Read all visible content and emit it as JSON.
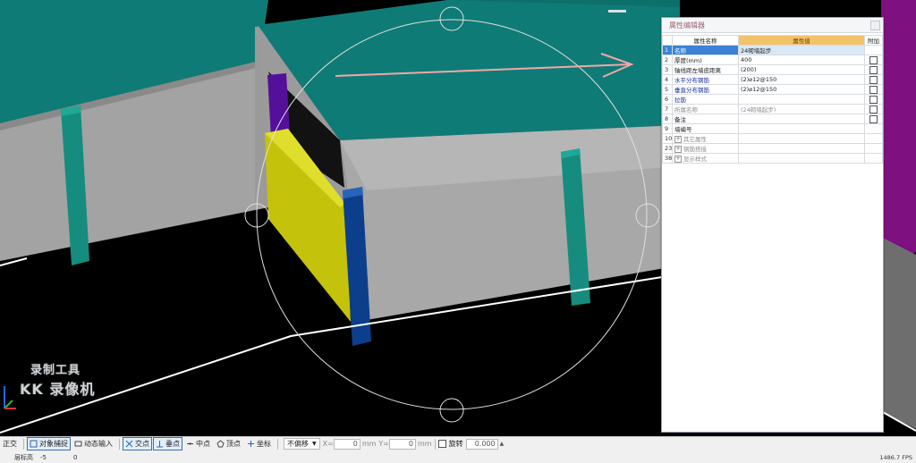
{
  "watermark": {
    "line1": "录制工具",
    "line2": "KK 录像机"
  },
  "panel": {
    "title": "属性编辑器",
    "headers": {
      "name": "属性名称",
      "value": "属性值",
      "attach": "附加"
    },
    "rows": [
      {
        "num": "1",
        "name": "名称",
        "value": "24砌墙起步",
        "selected": true,
        "checkbox": false,
        "style": "blue"
      },
      {
        "num": "2",
        "name": "厚度(mm)",
        "value": "400",
        "checkbox": true,
        "style": "normal"
      },
      {
        "num": "3",
        "name": "轴线距左墙皮距离",
        "value": "(200)",
        "checkbox": true,
        "style": "normal"
      },
      {
        "num": "4",
        "name": "水平分布钢筋",
        "value": "(2)⌀12@150",
        "checkbox": true,
        "style": "blue"
      },
      {
        "num": "5",
        "name": "垂直分布钢筋",
        "value": "(2)⌀12@150",
        "checkbox": true,
        "style": "blue"
      },
      {
        "num": "6",
        "name": "拉筋",
        "value": "",
        "checkbox": true,
        "style": "blue"
      },
      {
        "num": "7",
        "name": "所属名称",
        "value": "(24砌墙起步)",
        "checkbox": true,
        "style": "gray"
      },
      {
        "num": "8",
        "name": "备注",
        "value": "",
        "checkbox": true,
        "style": "normal"
      },
      {
        "num": "9",
        "name": "墙编号",
        "value": "",
        "checkbox": false,
        "style": "normal"
      },
      {
        "num": "10",
        "name": "其它属性",
        "value": "",
        "checkbox": false,
        "style": "gray",
        "expandable": true
      },
      {
        "num": "23",
        "name": "钢筋搭接",
        "value": "",
        "checkbox": false,
        "style": "gray",
        "expandable": true
      },
      {
        "num": "38",
        "name": "显示样式",
        "value": "",
        "checkbox": false,
        "style": "gray",
        "expandable": true
      }
    ]
  },
  "statusbar": {
    "snap": {
      "ortho": "正交",
      "object_snap": "对象捕捉",
      "dynamic_input": "动态输入",
      "intersection": "交点",
      "perpendicular": "垂点",
      "midpoint": "中点",
      "vertex": "顶点",
      "coordinate": "坐标"
    },
    "offset_mode": "不偏移",
    "x_label": "X=",
    "x_value": "0",
    "unit1": "mm",
    "y_label": "Y=",
    "y_value": "0",
    "unit2": "mm",
    "rotate_label": "旋转",
    "rotate_value": "0.000",
    "floor_label": "层标高",
    "floor_value": "-5",
    "fps": "1486.7 FPS",
    "row2_prefix": "",
    "row2_trail": "0"
  },
  "colors": {
    "slab": "#0f7b76",
    "wall": "#a7a7a7",
    "column_teal": "#16907f",
    "column_blue": "#0d3d8c",
    "yellow_wall": "#bcbc0a",
    "purple": "#7a0f7f",
    "accent_selected": "#3b82d6",
    "header_value_bg": "#f3c36a"
  }
}
